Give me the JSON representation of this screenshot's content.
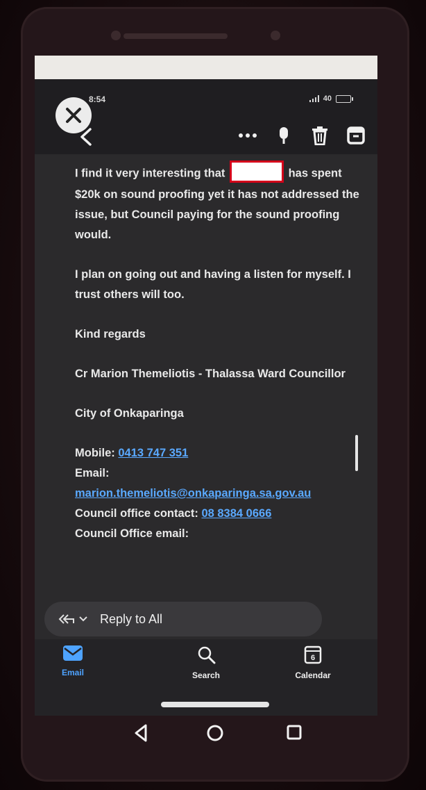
{
  "status_bar": {
    "time": "8:54",
    "right_text": "40"
  },
  "email": {
    "paragraph1_part1": "I find it very interesting that",
    "paragraph1_part2": "has spent $20k on sound proofing yet it has not addressed the issue, but Council paying for the sound proofing would.",
    "paragraph2": "I plan on going out and having a listen for myself. I trust others will too.",
    "closing": "Kind regards",
    "signature_name": "Cr Marion Themeliotis - Thalassa Ward Councillor",
    "organization": "City of Onkaparinga",
    "mobile_label": "Mobile:",
    "mobile_number": "0413 747 351",
    "email_label": "Email:",
    "email_address": "marion.themeliotis@onkaparinga.sa.gov.au",
    "council_contact_label": "Council office contact:",
    "council_contact_number": "08 8384 0666",
    "council_email_label": "Council Office email:"
  },
  "reply": {
    "label": "Reply to All"
  },
  "bottom_nav": {
    "items": [
      {
        "label": "Email",
        "icon": "email-icon",
        "active": true
      },
      {
        "label": "Search",
        "icon": "search-icon",
        "active": false
      },
      {
        "label": "Calendar",
        "icon": "calendar-icon",
        "active": false,
        "badge": "6"
      }
    ]
  },
  "colors": {
    "accent": "#4ea3ff",
    "link": "#5aa9ff",
    "redaction_border": "#d4001a",
    "background": "#2b2a2c"
  }
}
